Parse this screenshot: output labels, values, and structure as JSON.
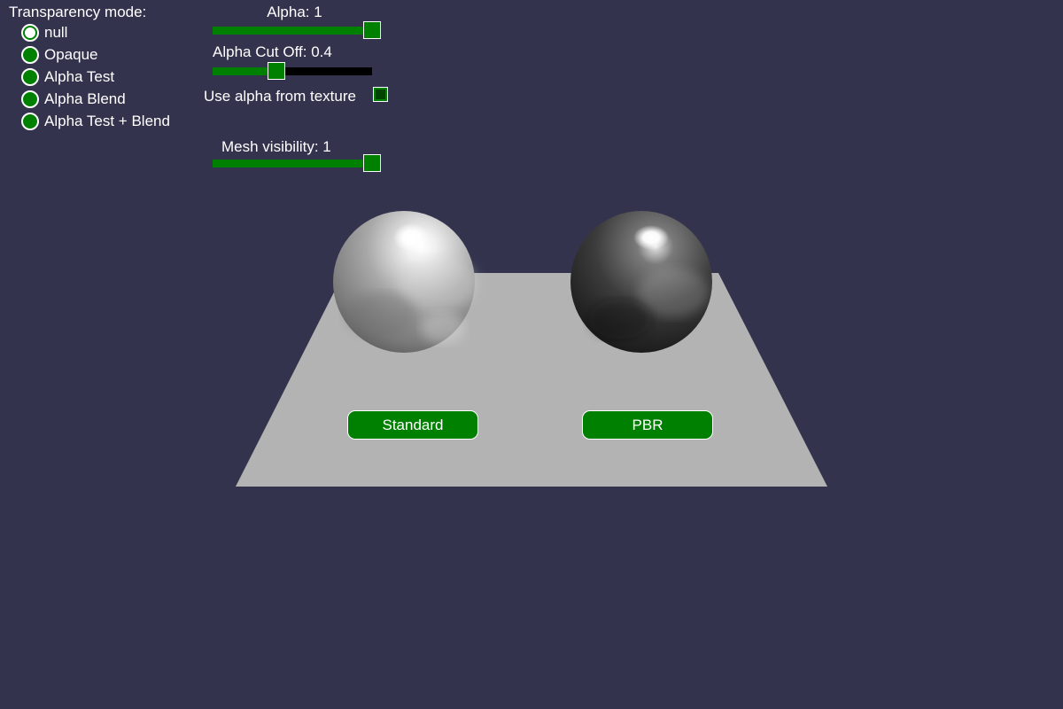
{
  "colors": {
    "background": "#33334d",
    "accent": "#008000",
    "ground": "#b3b3b3"
  },
  "transparency": {
    "title": "Transparency mode:",
    "options": [
      {
        "label": "null",
        "checked": true
      },
      {
        "label": "Opaque",
        "checked": false
      },
      {
        "label": "Alpha Test",
        "checked": false
      },
      {
        "label": "Alpha Blend",
        "checked": false
      },
      {
        "label": "Alpha Test + Blend",
        "checked": false
      }
    ]
  },
  "alpha": {
    "label": "Alpha: 1",
    "value": 1.0
  },
  "alpha_cutoff": {
    "label": "Alpha Cut Off: 0.4",
    "value": 0.4
  },
  "use_alpha_texture": {
    "label": "Use alpha from texture",
    "checked": true
  },
  "mesh_visibility": {
    "label": "Mesh visibility: 1",
    "value": 1.0
  },
  "scene": {
    "standard_label": "Standard",
    "pbr_label": "PBR"
  }
}
